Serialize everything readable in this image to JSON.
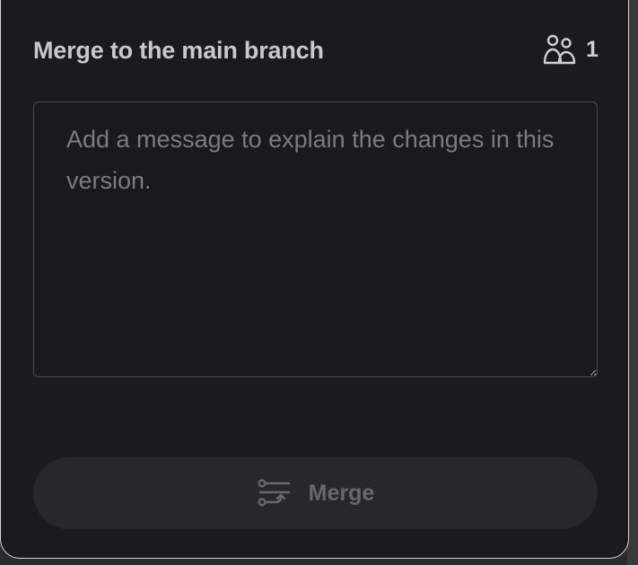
{
  "dialog": {
    "title": "Merge to the main branch",
    "collaborator_icon": "users-icon",
    "collaborator_count": "1",
    "message": {
      "value": "",
      "placeholder": "Add a message to explain the changes in this version."
    },
    "merge_button": {
      "label": "Merge",
      "icon": "merge-icon",
      "state": "disabled"
    }
  },
  "colors": {
    "panel_bg": "#1b1b1d",
    "panel_border": "#d4d4d6",
    "title_text": "#c9c9cc",
    "placeholder_text": "#7c7c80",
    "button_bg": "#28282a",
    "button_text_disabled": "#68686c"
  }
}
